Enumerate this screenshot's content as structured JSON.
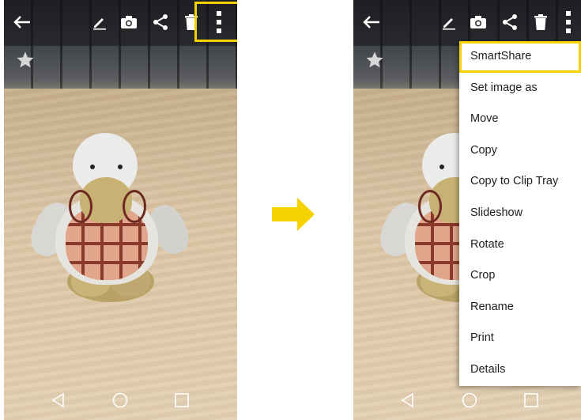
{
  "screens": {
    "before": {
      "toolbar": {
        "icons": [
          "back-arrow-icon",
          "edit-pencil-icon",
          "camera-icon",
          "share-icon",
          "trash-icon",
          "overflow-menu-icon"
        ],
        "highlighted": "overflow-menu-icon"
      },
      "favorite_icon": "star-icon",
      "navigation": [
        "back-triangle-icon",
        "home-circle-icon",
        "recents-square-icon"
      ]
    },
    "after": {
      "toolbar": {
        "icons": [
          "back-arrow-icon",
          "edit-pencil-icon",
          "camera-icon",
          "share-icon",
          "trash-icon",
          "overflow-menu-icon"
        ]
      },
      "overflow_menu": {
        "items": [
          {
            "label": "SmartShare",
            "highlighted": true
          },
          {
            "label": "Set image as"
          },
          {
            "label": "Move"
          },
          {
            "label": "Copy"
          },
          {
            "label": "Copy to Clip Tray"
          },
          {
            "label": "Slideshow"
          },
          {
            "label": "Rotate"
          },
          {
            "label": "Crop"
          },
          {
            "label": "Rename"
          },
          {
            "label": "Print"
          },
          {
            "label": "Details"
          }
        ]
      },
      "navigation": [
        "back-triangle-icon",
        "home-circle-icon",
        "recents-square-icon"
      ]
    }
  },
  "colors": {
    "highlight": "#f6d300",
    "arrow": "#f6d300",
    "menu_background": "#ffffff",
    "menu_text": "#1d1d1d"
  }
}
